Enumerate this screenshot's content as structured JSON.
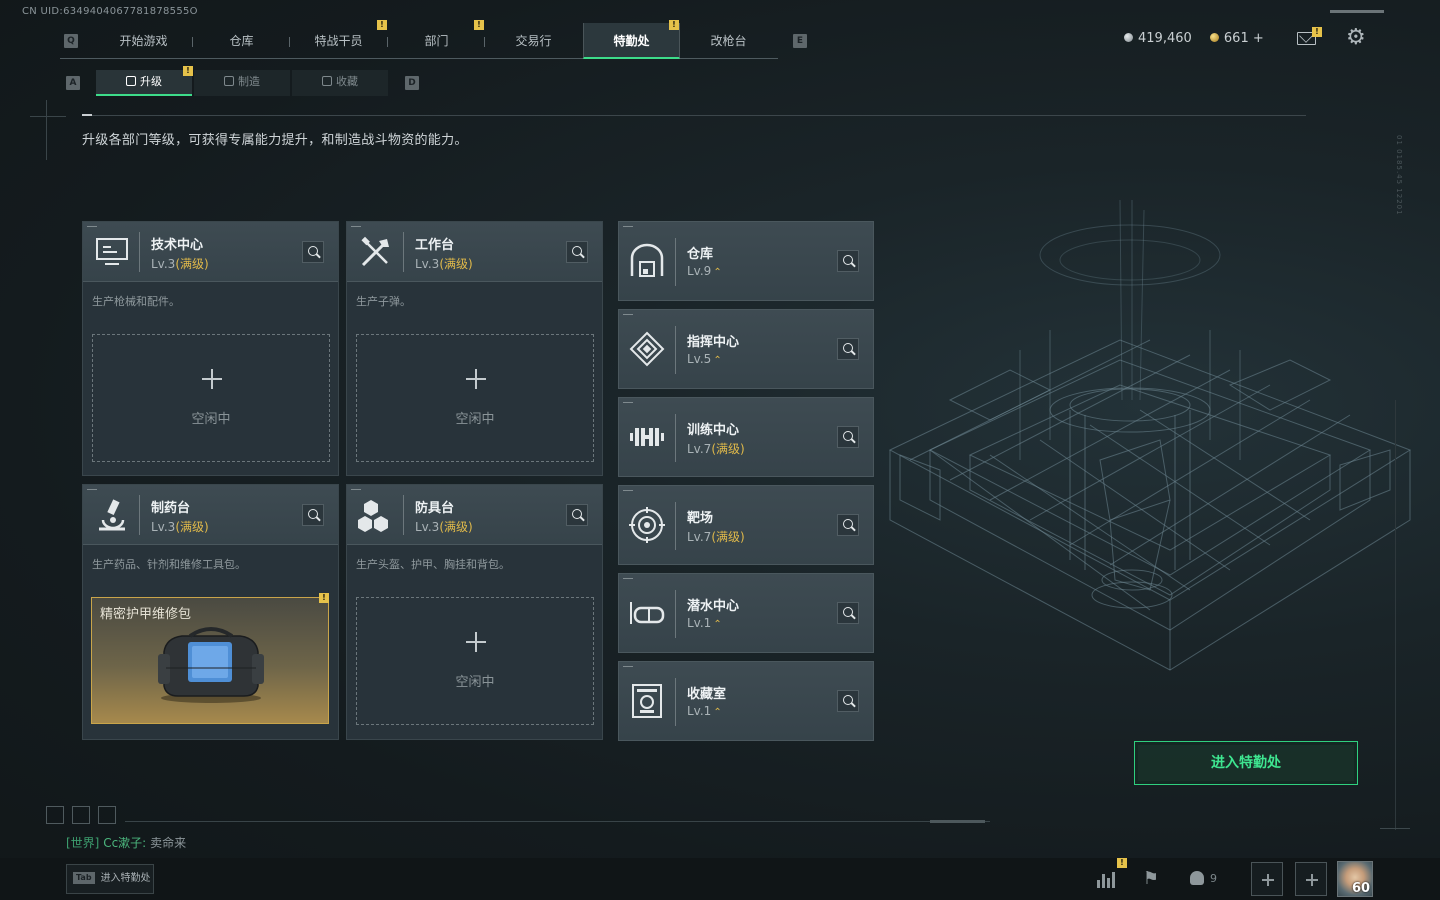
{
  "uid_text": "CN UID:6349404067781878555O",
  "nav": {
    "left_key": "Q",
    "right_key": "E",
    "tabs": [
      {
        "label": "开始游戏"
      },
      {
        "label": "仓库"
      },
      {
        "label": "特战干员"
      },
      {
        "label": "部门"
      },
      {
        "label": "交易行"
      },
      {
        "label": "特勤处"
      },
      {
        "label": "改枪台"
      }
    ],
    "active_index": 5
  },
  "currency": {
    "silver": "419,460",
    "gold": "661 +"
  },
  "sub_nav": {
    "left_key": "A",
    "right_key": "D",
    "tabs": [
      {
        "label": "升级"
      },
      {
        "label": "制造"
      },
      {
        "label": "收藏"
      }
    ]
  },
  "description": "升级各部门等级，可获得专属能力提升，和制造战斗物资的能力。",
  "idle_text": "空闲中",
  "stations": [
    {
      "name": "技术中心",
      "level": "Lv.3",
      "max": "(满级)",
      "desc": "生产枪械和配件。",
      "icon": "computer-icon"
    },
    {
      "name": "工作台",
      "level": "Lv.3",
      "max": "(满级)",
      "desc": "生产子弹。",
      "icon": "tools-icon"
    },
    {
      "name": "制药台",
      "level": "Lv.3",
      "max": "(满级)",
      "desc": "生产药品、针剂和维修工具包。",
      "icon": "microscope-icon",
      "item": "精密护甲维修包"
    },
    {
      "name": "防具台",
      "level": "Lv.3",
      "max": "(满级)",
      "desc": "生产头盔、护甲、胸挂和背包。",
      "icon": "cubes-icon"
    }
  ],
  "facilities": [
    {
      "name": "仓库",
      "level": "Lv.9",
      "max": "",
      "icon": "warehouse-icon"
    },
    {
      "name": "指挥中心",
      "level": "Lv.5",
      "max": "",
      "icon": "command-icon"
    },
    {
      "name": "训练中心",
      "level": "Lv.7",
      "max": "(满级)",
      "icon": "dumbbell-icon"
    },
    {
      "name": "靶场",
      "level": "Lv.7",
      "max": "(满级)",
      "icon": "target-icon"
    },
    {
      "name": "潜水中心",
      "level": "Lv.1",
      "max": "",
      "icon": "goggles-icon"
    },
    {
      "name": "收藏室",
      "level": "Lv.1",
      "max": "",
      "icon": "trophy-icon"
    }
  ],
  "enter_button": "进入特勤处",
  "chat": {
    "channel": "[世界]",
    "sender": "Cc漱子:",
    "message": "卖命来"
  },
  "tab_hint": {
    "key": "Tab",
    "label": "进入特勤处"
  },
  "friends_count": "9",
  "player_level": "60",
  "badge_mark": "!",
  "colors": {
    "accent": "#3ddc8a",
    "max_level": "#e0b94a",
    "badge": "#e6c24a"
  }
}
